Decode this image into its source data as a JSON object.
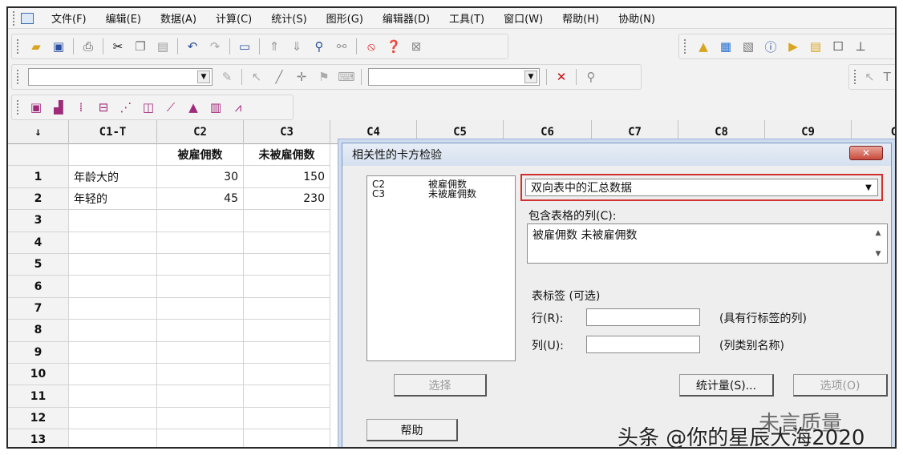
{
  "menubar": {
    "items": [
      "文件(F)",
      "编辑(E)",
      "数据(A)",
      "计算(C)",
      "统计(S)",
      "图形(G)",
      "编辑器(D)",
      "工具(T)",
      "窗口(W)",
      "帮助(H)",
      "协助(N)"
    ]
  },
  "worksheet": {
    "column_headers": [
      "↓",
      "C1-T",
      "C2",
      "C3",
      "C4",
      "C5",
      "C6",
      "C7",
      "C8",
      "C9",
      "C"
    ],
    "column_names": [
      "",
      "被雇佣数",
      "未被雇佣数"
    ],
    "rows": [
      {
        "num": "1",
        "c1": "年龄大的",
        "c2": "30",
        "c3": "150"
      },
      {
        "num": "2",
        "c1": "年轻的",
        "c2": "45",
        "c3": "230"
      },
      {
        "num": "3",
        "c1": "",
        "c2": "",
        "c3": ""
      },
      {
        "num": "4",
        "c1": "",
        "c2": "",
        "c3": ""
      },
      {
        "num": "5",
        "c1": "",
        "c2": "",
        "c3": ""
      },
      {
        "num": "6",
        "c1": "",
        "c2": "",
        "c3": ""
      },
      {
        "num": "7",
        "c1": "",
        "c2": "",
        "c3": ""
      },
      {
        "num": "8",
        "c1": "",
        "c2": "",
        "c3": ""
      },
      {
        "num": "9",
        "c1": "",
        "c2": "",
        "c3": ""
      },
      {
        "num": "10",
        "c1": "",
        "c2": "",
        "c3": ""
      },
      {
        "num": "11",
        "c1": "",
        "c2": "",
        "c3": ""
      },
      {
        "num": "12",
        "c1": "",
        "c2": "",
        "c3": ""
      },
      {
        "num": "13",
        "c1": "",
        "c2": "",
        "c3": ""
      }
    ]
  },
  "dialog": {
    "title": "相关性的卡方检验",
    "close_label": "✕",
    "variables": [
      {
        "code": "C2",
        "name": "被雇佣数"
      },
      {
        "code": "C3",
        "name": "未被雇佣数"
      }
    ],
    "mode_value": "双向表中的汇总数据",
    "columns_label": "包含表格的列(C):",
    "columns_value": "被雇佣数 未被雇佣数",
    "labels_section": "表标签 (可选)",
    "row_label": "行(R):",
    "row_hint": "(具有行标签的列)",
    "col_label": "列(U):",
    "col_hint": "(列类别名称)",
    "select_button": "选择",
    "stats_button": "统计量(S)...",
    "options_button": "选项(O)",
    "help_button": "帮助"
  },
  "watermark": {
    "text": "头条 @你的星辰大海2020",
    "logo_text": "未言质量"
  },
  "colors": {
    "highlight_border": "#d23030",
    "title_gradient": "#d5e0ef",
    "close_button": "#c8493a"
  }
}
